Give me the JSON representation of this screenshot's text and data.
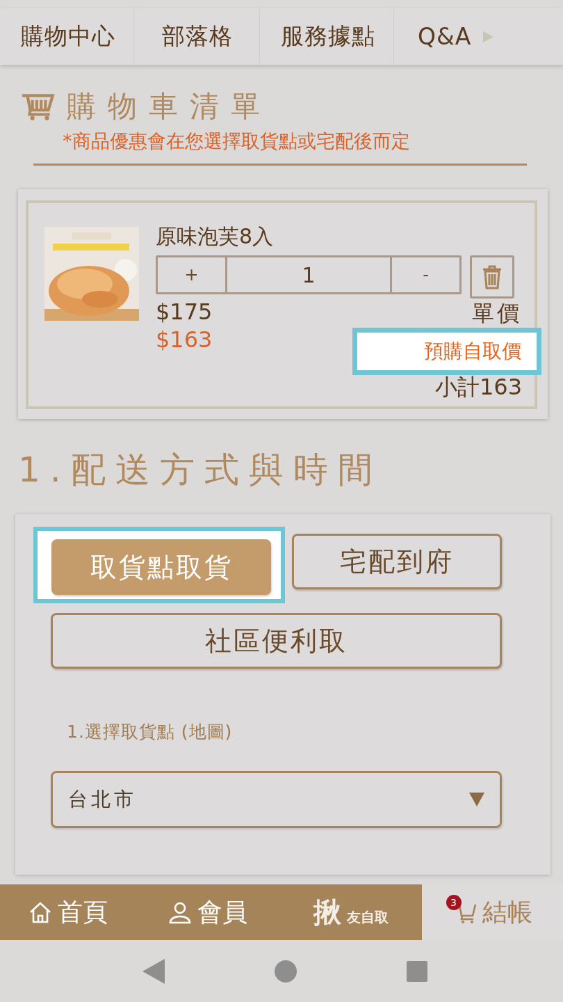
{
  "top_nav": {
    "items": [
      {
        "label": "購物中心"
      },
      {
        "label": "部落格"
      },
      {
        "label": "服務據點"
      },
      {
        "label": "Q&A"
      }
    ]
  },
  "cart": {
    "title": "購物車清單",
    "notice": "*商品優惠會在您選擇取貨點或宅配後而定",
    "items": [
      {
        "name": "原味泡芙8入",
        "kind": "picture",
        "plus": "+",
        "quantity": "1",
        "minus": "-",
        "price": "$175",
        "discount_price": "$163",
        "unit_label": "單價",
        "subtotal": "小計163",
        "tooltip": "預購自取價"
      }
    ]
  },
  "delivery": {
    "heading": "1.配送方式與時間",
    "options": [
      {
        "label": "取貨點取貨",
        "selected": true,
        "highlighted": true
      },
      {
        "label": "宅配到府",
        "selected": false,
        "highlighted": false
      },
      {
        "label": "社區便利取",
        "selected": false,
        "highlighted": false
      }
    ],
    "pickup_label": "1.選擇取貨點 (地圖)",
    "city_select": {
      "value": "台北市"
    }
  },
  "bottom_nav": {
    "items": [
      {
        "kind": "home",
        "label": "首頁",
        "selected": false
      },
      {
        "kind": "member",
        "label": "會員",
        "selected": false
      },
      {
        "kind": "logo",
        "label": "揪",
        "sublabel": "友自取",
        "selected": false
      },
      {
        "kind": "cart",
        "label": "結帳",
        "badge": "3",
        "selected": true
      }
    ]
  }
}
